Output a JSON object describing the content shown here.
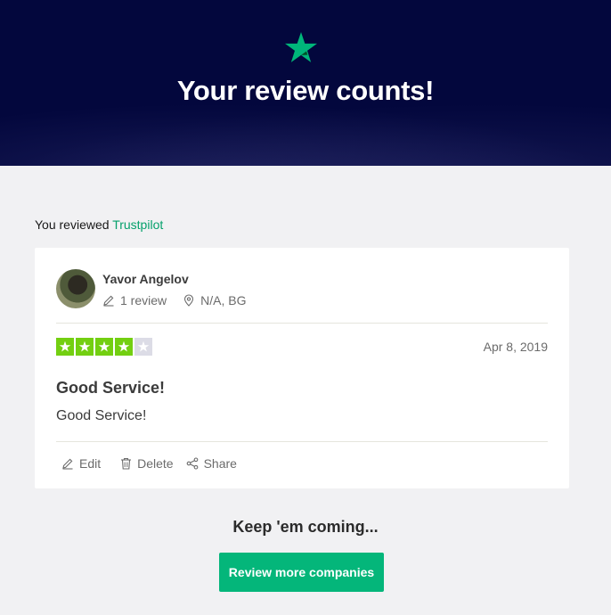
{
  "hero": {
    "title": "Your review counts!",
    "star_icon": "star-icon",
    "accent": "#00b67a",
    "background": "#03073d"
  },
  "reviewed": {
    "prefix": "You reviewed",
    "company": "Trustpilot"
  },
  "review": {
    "reviewer_name": "Yavor Angelov",
    "review_count": "1 review",
    "location": "N/A, BG",
    "rating": 4,
    "max_rating": 5,
    "star_color": "#73cf11",
    "date": "Apr 8, 2019",
    "title": "Good Service!",
    "body": "Good Service!"
  },
  "actions": {
    "edit": "Edit",
    "delete": "Delete",
    "share": "Share"
  },
  "footer": {
    "keep_text": "Keep 'em coming...",
    "cta_label": "Review more companies",
    "cta_color": "#04b67a"
  }
}
